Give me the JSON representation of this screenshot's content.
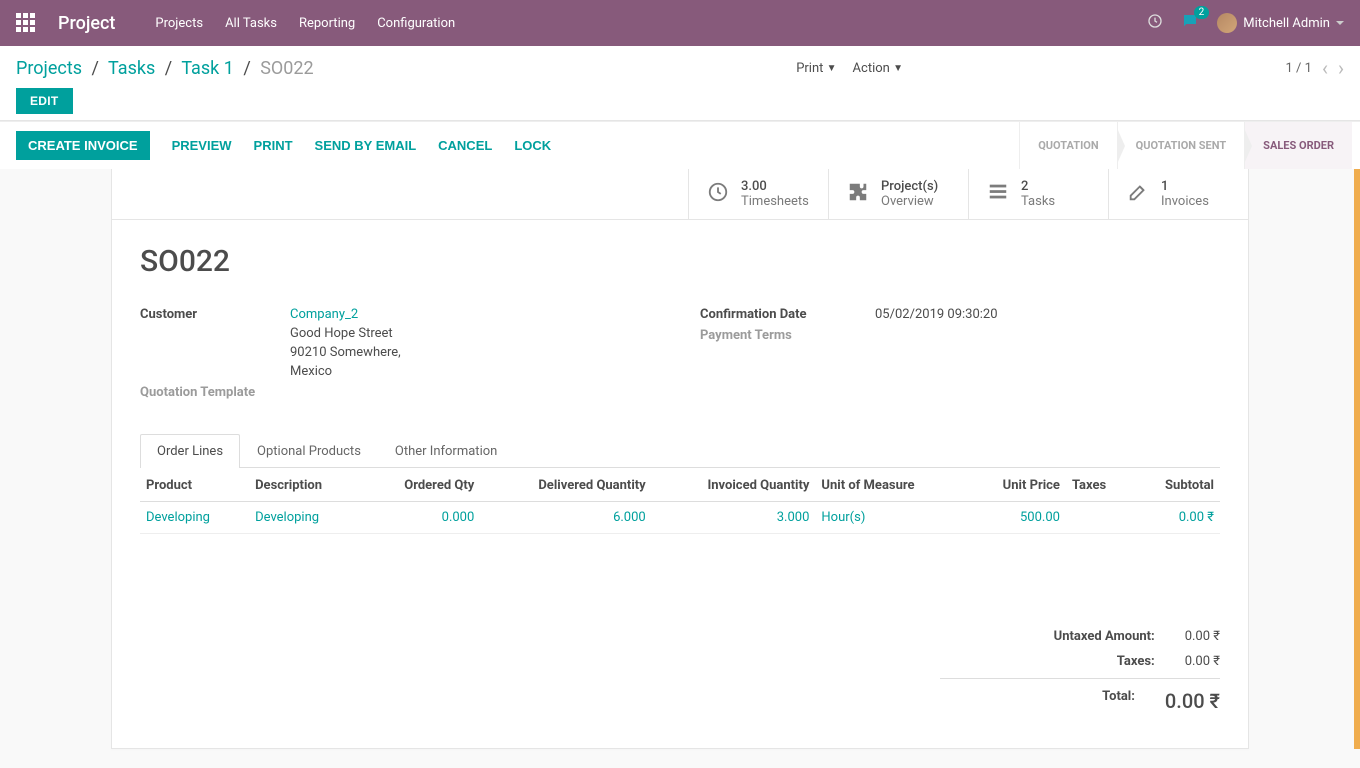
{
  "nav": {
    "brand": "Project",
    "menu": [
      "Projects",
      "All Tasks",
      "Reporting",
      "Configuration"
    ],
    "chat_badge": "2",
    "user": "Mitchell Admin"
  },
  "breadcrumbs": {
    "items": [
      "Projects",
      "Tasks",
      "Task 1"
    ],
    "active": "SO022"
  },
  "cp": {
    "edit": "EDIT",
    "print": "Print",
    "action": "Action",
    "pager": "1 / 1"
  },
  "action_buttons": {
    "create_invoice": "CREATE INVOICE",
    "preview": "PREVIEW",
    "print": "PRINT",
    "send_by_email": "SEND BY EMAIL",
    "cancel": "CANCEL",
    "lock": "LOCK"
  },
  "status": {
    "quotation": "QUOTATION",
    "quotation_sent": "QUOTATION SENT",
    "sales_order": "SALES ORDER"
  },
  "stat_buttons": {
    "timesheets_n": "3.00",
    "timesheets_l": "Timesheets",
    "projects_n": "Project(s)",
    "projects_l": "Overview",
    "tasks_n": "2",
    "tasks_l": "Tasks",
    "invoices_n": "1",
    "invoices_l": "Invoices"
  },
  "record": {
    "title": "SO022",
    "customer_label": "Customer",
    "customer_name": "Company_2",
    "customer_addr1": "Good Hope Street",
    "customer_addr2": "90210 Somewhere,",
    "customer_addr3": "Mexico",
    "quotation_template_label": "Quotation Template",
    "confirmation_date_label": "Confirmation Date",
    "confirmation_date": "05/02/2019 09:30:20",
    "payment_terms_label": "Payment Terms"
  },
  "tabs": {
    "order_lines": "Order Lines",
    "optional_products": "Optional Products",
    "other_information": "Other Information"
  },
  "columns": {
    "product": "Product",
    "description": "Description",
    "ordered_qty": "Ordered Qty",
    "delivered_qty": "Delivered Quantity",
    "invoiced_qty": "Invoiced Quantity",
    "uom": "Unit of Measure",
    "unit_price": "Unit Price",
    "taxes": "Taxes",
    "subtotal": "Subtotal"
  },
  "lines": [
    {
      "product": "Developing",
      "description": "Developing",
      "ordered_qty": "0.000",
      "delivered_qty": "6.000",
      "invoiced_qty": "3.000",
      "uom": "Hour(s)",
      "unit_price": "500.00",
      "taxes": "",
      "subtotal": "0.00 ₹"
    }
  ],
  "totals": {
    "untaxed_label": "Untaxed Amount:",
    "untaxed_value": "0.00 ₹",
    "taxes_label": "Taxes:",
    "taxes_value": "0.00 ₹",
    "total_label": "Total:",
    "total_value": "0.00 ₹"
  }
}
